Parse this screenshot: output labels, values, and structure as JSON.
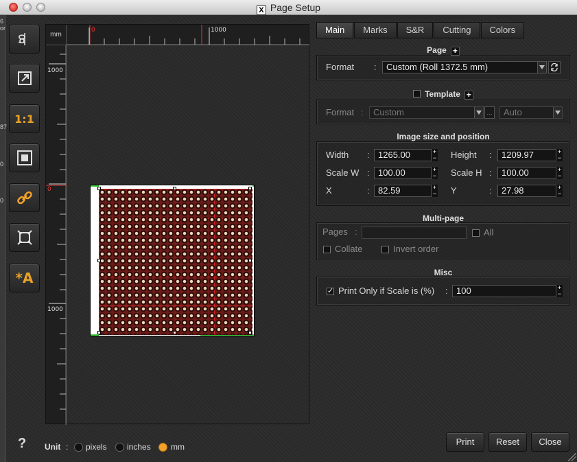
{
  "window": {
    "title": "Page Setup"
  },
  "left_edge": {
    "fragments": [
      "6",
      "or",
      "87",
      "0",
      "0"
    ]
  },
  "toolbar": {
    "buttons": [
      {
        "icon": "mirror-icon"
      },
      {
        "icon": "export-icon"
      },
      {
        "icon": "actual-size-icon",
        "label": "1:1"
      },
      {
        "icon": "fit-page-icon"
      },
      {
        "icon": "link-icon"
      },
      {
        "icon": "fit-selection-icon"
      },
      {
        "icon": "auto-text-icon",
        "label": "*A"
      }
    ]
  },
  "preview": {
    "unit_corner": "mm",
    "hruler": {
      "label_zero": "0",
      "label_1000": "1000"
    },
    "vruler": {
      "label_1000_top": "1000",
      "label_zero": "0",
      "label_1000_bottom": "1000"
    }
  },
  "tabs": [
    {
      "label": "Main",
      "active": true
    },
    {
      "label": "Marks",
      "active": false
    },
    {
      "label": "S&R",
      "active": false
    },
    {
      "label": "Cutting",
      "active": false
    },
    {
      "label": "Colors",
      "active": false
    }
  ],
  "page_group": {
    "title": "Page",
    "format_label": "Format",
    "format_value": "Custom (Roll 1372.5 mm)"
  },
  "template_group": {
    "title": "Template",
    "checked": false,
    "format_label": "Format",
    "format_value": "Custom",
    "ellipsis": "...",
    "auto_value": "Auto"
  },
  "image_group": {
    "title": "Image size and position",
    "width_label": "Width",
    "width_value": "1265.00",
    "height_label": "Height",
    "height_value": "1209.97",
    "scalew_label": "Scale W",
    "scalew_value": "100.00",
    "scaleh_label": "Scale H",
    "scaleh_value": "100.00",
    "x_label": "X",
    "x_value": "82.59",
    "y_label": "Y",
    "y_value": "27.98"
  },
  "multipage_group": {
    "title": "Multi-page",
    "pages_label": "Pages",
    "pages_value": "",
    "all_label": "All",
    "collate_label": "Collate",
    "invert_label": "Invert order"
  },
  "misc_group": {
    "title": "Misc",
    "print_only_label": "Print Only if Scale is (%)",
    "print_only_checked": true,
    "scale_value": "100"
  },
  "bottom": {
    "help": "?",
    "unit_label": "Unit",
    "units": [
      {
        "label": "pixels",
        "selected": false
      },
      {
        "label": "inches",
        "selected": false
      },
      {
        "label": "mm",
        "selected": true
      }
    ],
    "print_label": "Print",
    "reset_label": "Reset",
    "close_label": "Close"
  },
  "colors": {
    "accent": "#f2a229",
    "ruler_marker": "#e23a3a",
    "page_edge": "#3fd13f"
  }
}
